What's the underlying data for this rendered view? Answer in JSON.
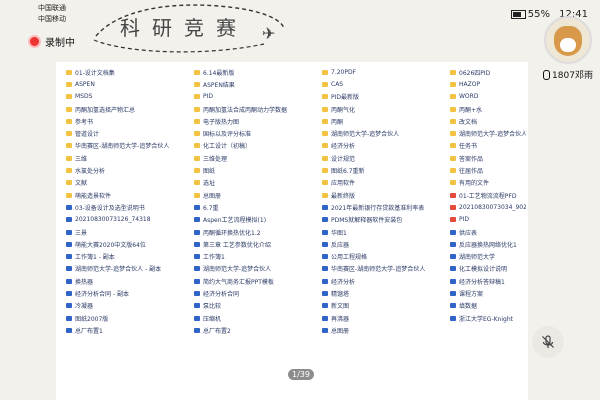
{
  "status_bar": {
    "carrier_1": "中国联通",
    "carrier_2": "中国移动",
    "battery": "55%",
    "time": "12:41",
    "record_label": "录制中"
  },
  "banner": {
    "title": "科研竞赛"
  },
  "columns": [
    [
      {
        "icon": "folder",
        "label": "01-设计文档集"
      },
      {
        "icon": "folder",
        "label": "ASPEN"
      },
      {
        "icon": "folder",
        "label": "MSDS"
      },
      {
        "icon": "folder",
        "label": "丙酮加氢选择产物汇总"
      },
      {
        "icon": "folder",
        "label": "参考书"
      },
      {
        "icon": "folder",
        "label": "管道设计"
      },
      {
        "icon": "folder",
        "label": "华南赛区-湖南师范大学-追梦合伙人"
      },
      {
        "icon": "folder",
        "label": "三维"
      },
      {
        "icon": "folder",
        "label": "水氯处分析"
      },
      {
        "icon": "folder",
        "label": "文献"
      },
      {
        "icon": "folder",
        "label": "萌能造景软件"
      },
      {
        "icon": "doc",
        "label": "03-设备设计及选型说明书"
      },
      {
        "icon": "doc",
        "label": "20210830073126_74318"
      },
      {
        "icon": "doc",
        "label": "三景"
      },
      {
        "icon": "doc",
        "label": "萌能大赛2020中文版64位"
      },
      {
        "icon": "doc",
        "label": "工作簿1 - 副本"
      },
      {
        "icon": "doc",
        "label": "湖南师范大学-追梦合伙人 - 副本"
      },
      {
        "icon": "doc",
        "label": "换热器"
      },
      {
        "icon": "doc",
        "label": "经济分析合同 - 副本"
      },
      {
        "icon": "doc",
        "label": "冷凝器"
      },
      {
        "icon": "doc",
        "label": "图纸2007版"
      },
      {
        "icon": "doc",
        "label": "总厂布置1"
      }
    ],
    [
      {
        "icon": "folder",
        "label": "6.14最新版"
      },
      {
        "icon": "folder",
        "label": "ASPEN结果"
      },
      {
        "icon": "folder",
        "label": "PID"
      },
      {
        "icon": "folder",
        "label": "丙酮加氢法合成丙酮动力学数据"
      },
      {
        "icon": "folder",
        "label": "电子版热力图"
      },
      {
        "icon": "folder",
        "label": "国标以及评分标准"
      },
      {
        "icon": "folder",
        "label": "化工设计（初稿）"
      },
      {
        "icon": "folder",
        "label": "三维处理"
      },
      {
        "icon": "folder",
        "label": "图纸"
      },
      {
        "icon": "folder",
        "label": "选址"
      },
      {
        "icon": "folder",
        "label": "总图册"
      },
      {
        "icon": "doc",
        "label": "6.7重"
      },
      {
        "icon": "doc",
        "label": "Aspen工艺流程模拟(1)"
      },
      {
        "icon": "doc",
        "label": "丙酮循环换热优化1.2"
      },
      {
        "icon": "doc",
        "label": "第三章 工艺参数优化介绍"
      },
      {
        "icon": "doc",
        "label": "工作簿1"
      },
      {
        "icon": "doc",
        "label": "湖南师范大学-追梦合伙人"
      },
      {
        "icon": "doc",
        "label": "简约大气商务汇报PPT模板"
      },
      {
        "icon": "doc",
        "label": "经济分析合同"
      },
      {
        "icon": "doc",
        "label": "泵比较"
      },
      {
        "icon": "doc",
        "label": "压缩机"
      },
      {
        "icon": "doc",
        "label": "总厂布置2"
      }
    ],
    [
      {
        "icon": "folder",
        "label": "7.20PDF"
      },
      {
        "icon": "folder",
        "label": "CAS"
      },
      {
        "icon": "folder",
        "label": "PID最新版"
      },
      {
        "icon": "folder",
        "label": "丙酮气化"
      },
      {
        "icon": "folder",
        "label": "丙酮"
      },
      {
        "icon": "folder",
        "label": "湖南师范大学-追梦合伙人"
      },
      {
        "icon": "folder",
        "label": "经济分析"
      },
      {
        "icon": "folder",
        "label": "设计规范"
      },
      {
        "icon": "folder",
        "label": "图纸6.7重新"
      },
      {
        "icon": "folder",
        "label": "应用软件"
      },
      {
        "icon": "folder",
        "label": "最新终版"
      },
      {
        "icon": "doc",
        "label": "2021年最新银行存贷款基准利率表"
      },
      {
        "icon": "doc",
        "label": "PDMS就解释器软件安装包"
      },
      {
        "icon": "doc",
        "label": "华图1"
      },
      {
        "icon": "doc",
        "label": "反应器"
      },
      {
        "icon": "doc",
        "label": "公用工程规格"
      },
      {
        "icon": "doc",
        "label": "华南赛区-湖南师范大学-追梦合伙人"
      },
      {
        "icon": "doc",
        "label": "经济分析"
      },
      {
        "icon": "doc",
        "label": "精馏塔"
      },
      {
        "icon": "doc",
        "label": "新文图"
      },
      {
        "icon": "doc",
        "label": "再沸器"
      },
      {
        "icon": "doc",
        "label": "总图册"
      }
    ],
    [
      {
        "icon": "folder",
        "label": "0626四PID"
      },
      {
        "icon": "folder",
        "label": "HAZOP"
      },
      {
        "icon": "folder",
        "label": "WORD"
      },
      {
        "icon": "folder",
        "label": "丙酮+水"
      },
      {
        "icon": "folder",
        "label": "改文档"
      },
      {
        "icon": "folder",
        "label": "湖南师范大学-追梦合伙人（版重）"
      },
      {
        "icon": "folder",
        "label": "任务书"
      },
      {
        "icon": "folder",
        "label": "答案作品"
      },
      {
        "icon": "folder",
        "label": "往届作品"
      },
      {
        "icon": "folder",
        "label": "有用的文件"
      },
      {
        "icon": "pdf",
        "label": "01-工艺物流流程PFD"
      },
      {
        "icon": "pdf",
        "label": "20210830073034_90236"
      },
      {
        "icon": "pdf",
        "label": "PID"
      },
      {
        "icon": "doc",
        "label": "供应表"
      },
      {
        "icon": "doc",
        "label": "反应器换热网络优化1"
      },
      {
        "icon": "doc",
        "label": "湖南师范大学"
      },
      {
        "icon": "doc",
        "label": "化工模拟设计说明"
      },
      {
        "icon": "doc",
        "label": "经济分析答辩稿1"
      },
      {
        "icon": "doc",
        "label": "课程方案"
      },
      {
        "icon": "doc",
        "label": "填数据"
      },
      {
        "icon": "doc",
        "label": "浙江大学EG-Knight"
      }
    ]
  ],
  "pager": "1/39",
  "user": {
    "name": "1807邓雨"
  }
}
